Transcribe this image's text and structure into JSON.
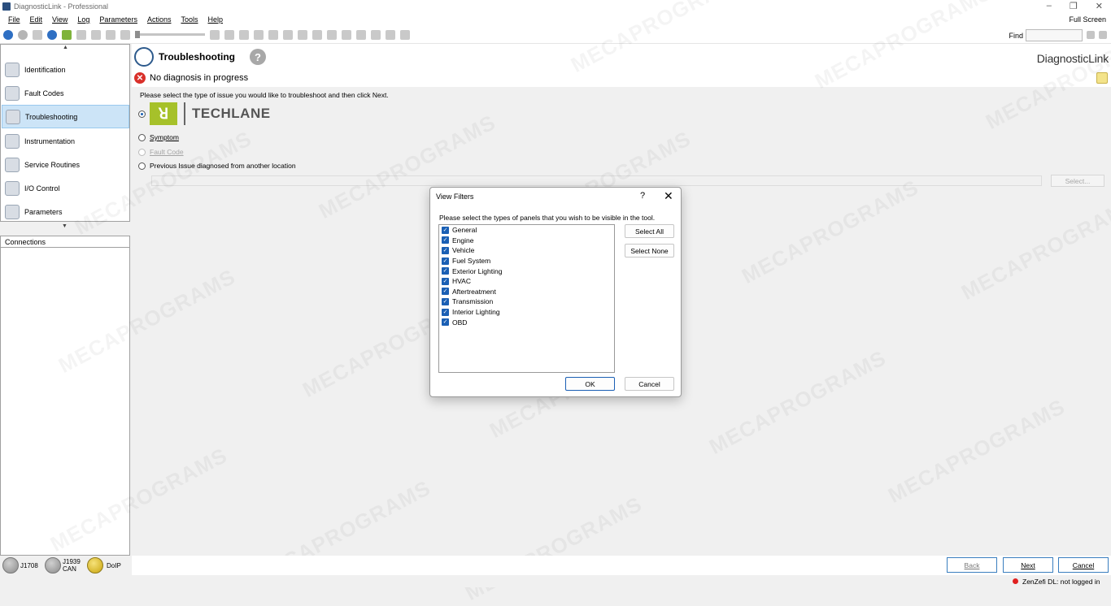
{
  "window": {
    "title": "DiagnosticLink - Professional",
    "fullscreen_label": "Full Screen"
  },
  "menu": [
    "File",
    "Edit",
    "View",
    "Log",
    "Parameters",
    "Actions",
    "Tools",
    "Help"
  ],
  "toolbar": {
    "find_label": "Find",
    "find_value": ""
  },
  "sidebar": {
    "items": [
      {
        "label": "Identification",
        "icon": "identification-icon"
      },
      {
        "label": "Fault Codes",
        "icon": "fault-codes-icon"
      },
      {
        "label": "Troubleshooting",
        "icon": "stethoscope-icon"
      },
      {
        "label": "Instrumentation",
        "icon": "instrumentation-icon"
      },
      {
        "label": "Service Routines",
        "icon": "service-routines-icon"
      },
      {
        "label": "I/O Control",
        "icon": "io-control-icon"
      },
      {
        "label": "Parameters",
        "icon": "parameters-icon"
      }
    ],
    "selected": "Troubleshooting"
  },
  "connections": {
    "header": "Connections"
  },
  "main": {
    "title": "Troubleshooting",
    "brand": "DiagnosticLink",
    "status": "No diagnosis in progress",
    "instruction": "Please select the type of issue you would like to troubleshoot and then click Next.",
    "techlane_label": "TECHLANE",
    "options": {
      "symptom": "Symptom",
      "fault_code": "Fault Code",
      "previous": "Previous Issue diagnosed from another location"
    },
    "select_button": "Select..."
  },
  "dialog": {
    "title": "View Filters",
    "help": "?",
    "close": "✕",
    "instruction": "Please select the types of panels that you wish to be visible in the tool.",
    "items": [
      {
        "label": "General",
        "checked": true
      },
      {
        "label": "Engine",
        "checked": true
      },
      {
        "label": "Vehicle",
        "checked": true
      },
      {
        "label": "Fuel System",
        "checked": true
      },
      {
        "label": "Exterior Lighting",
        "checked": true
      },
      {
        "label": "HVAC",
        "checked": true
      },
      {
        "label": "Aftertreatment",
        "checked": true
      },
      {
        "label": "Transmission",
        "checked": true
      },
      {
        "label": "Interior Lighting",
        "checked": true
      },
      {
        "label": "OBD",
        "checked": true
      }
    ],
    "select_all": "Select All",
    "select_none": "Select None",
    "ok": "OK",
    "cancel": "Cancel"
  },
  "bottom": {
    "leds": [
      {
        "label": "J1708",
        "color": "#9a9a9a"
      },
      {
        "label": "J1939 CAN",
        "color": "#9a9a9a"
      },
      {
        "label": "DoIP",
        "color": "#d8b51c"
      }
    ],
    "back": "Back",
    "next": "Next",
    "cancel": "Cancel",
    "login_status": "ZenZefi DL: not logged in"
  },
  "watermark": "MECAPROGRAMS"
}
